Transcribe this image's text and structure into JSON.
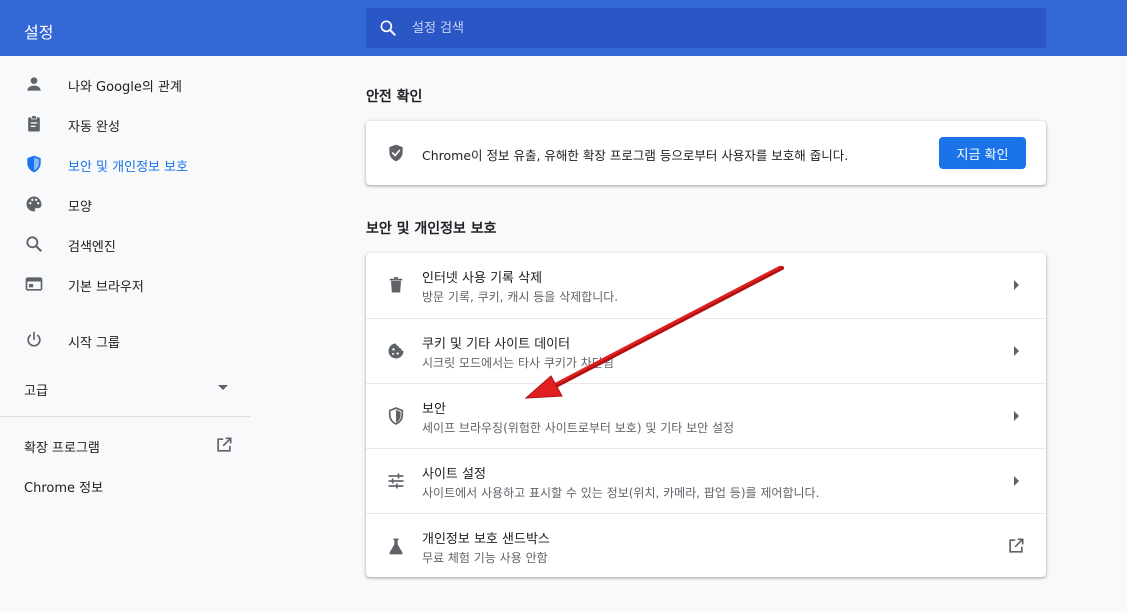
{
  "app": {
    "title": "설정"
  },
  "search": {
    "placeholder": "설정 검색"
  },
  "sidebar": {
    "items": [
      {
        "label": "나와 Google의 관계",
        "icon": "person-icon"
      },
      {
        "label": "자동 완성",
        "icon": "clipboard-icon"
      },
      {
        "label": "보안 및 개인정보 보호",
        "icon": "shield-icon",
        "active": true
      },
      {
        "label": "모양",
        "icon": "palette-icon"
      },
      {
        "label": "검색엔진",
        "icon": "search-icon"
      },
      {
        "label": "기본 브라우저",
        "icon": "browser-window-icon"
      },
      {
        "label": "시작 그룹",
        "icon": "power-icon"
      }
    ],
    "advanced_label": "고급",
    "extensions_label": "확장 프로그램",
    "about_label": "Chrome 정보"
  },
  "safety_check": {
    "section_title": "안전 확인",
    "description": "Chrome이 정보 유출, 유해한 확장 프로그램 등으로부터 사용자를 보호해 줍니다.",
    "button_label": "지금 확인"
  },
  "privacy": {
    "section_title": "보안 및 개인정보 보호",
    "rows": [
      {
        "title": "인터넷 사용 기록 삭제",
        "subtitle": "방문 기록, 쿠키, 캐시 등을 삭제합니다.",
        "icon": "trash-icon"
      },
      {
        "title": "쿠키 및 기타 사이트 데이터",
        "subtitle": "시크릿 모드에서는 타사 쿠키가 차단됨",
        "icon": "cookie-icon"
      },
      {
        "title": "보안",
        "subtitle": "세이프 브라우징(위험한 사이트로부터 보호) 및 기타 보안 설정",
        "icon": "shield-outline-icon"
      },
      {
        "title": "사이트 설정",
        "subtitle": "사이트에서 사용하고 표시할 수 있는 정보(위치, 카메라, 팝업 등)를 제어합니다.",
        "icon": "tune-icon"
      },
      {
        "title": "개인정보 보호 샌드박스",
        "subtitle": "무료 체험 기능 사용 안함",
        "icon": "flask-icon"
      }
    ]
  },
  "colors": {
    "header_bg": "#3367d6",
    "search_bg": "#2a56c6",
    "accent": "#1a73e8",
    "annotation_arrow": "#e02020"
  }
}
